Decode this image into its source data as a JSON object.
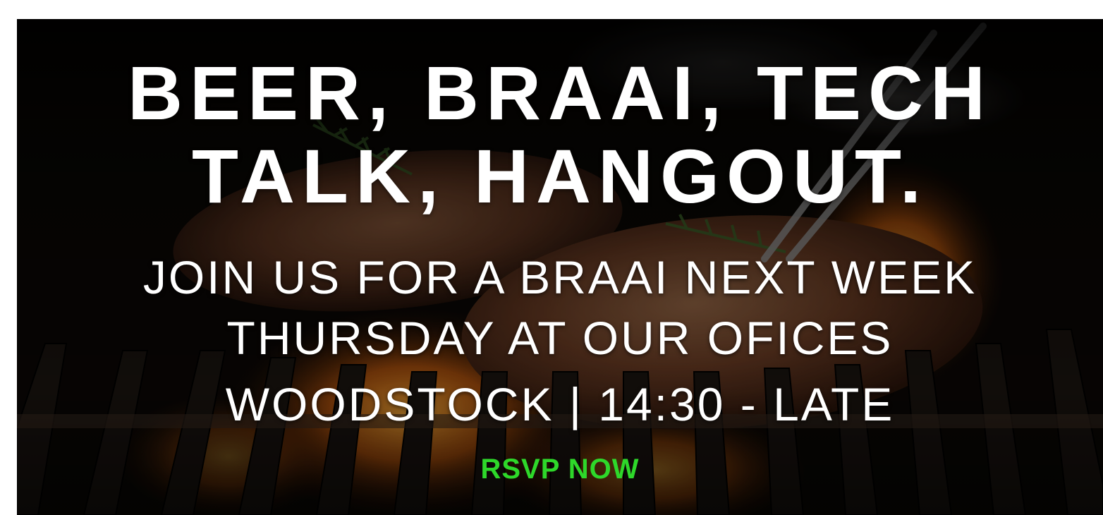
{
  "banner": {
    "headline_line1": "BEER, BRAAI, TECH",
    "headline_line2": "TALK, HANGOUT.",
    "details_line1": "JOIN US FOR A BRAAI NEXT WEEK",
    "details_line2": "THURSDAY AT OUR OFICES",
    "details_line3": "WOODSTOCK | 14:30 - LATE",
    "rsvp_label": "RSVP NOW",
    "background_image": "grilled-steak-on-braai-grill-photo"
  },
  "colors": {
    "text": "#ffffff",
    "rsvp": "#2ed82a",
    "background": "#0a0806",
    "flame": "#f08a1c"
  }
}
